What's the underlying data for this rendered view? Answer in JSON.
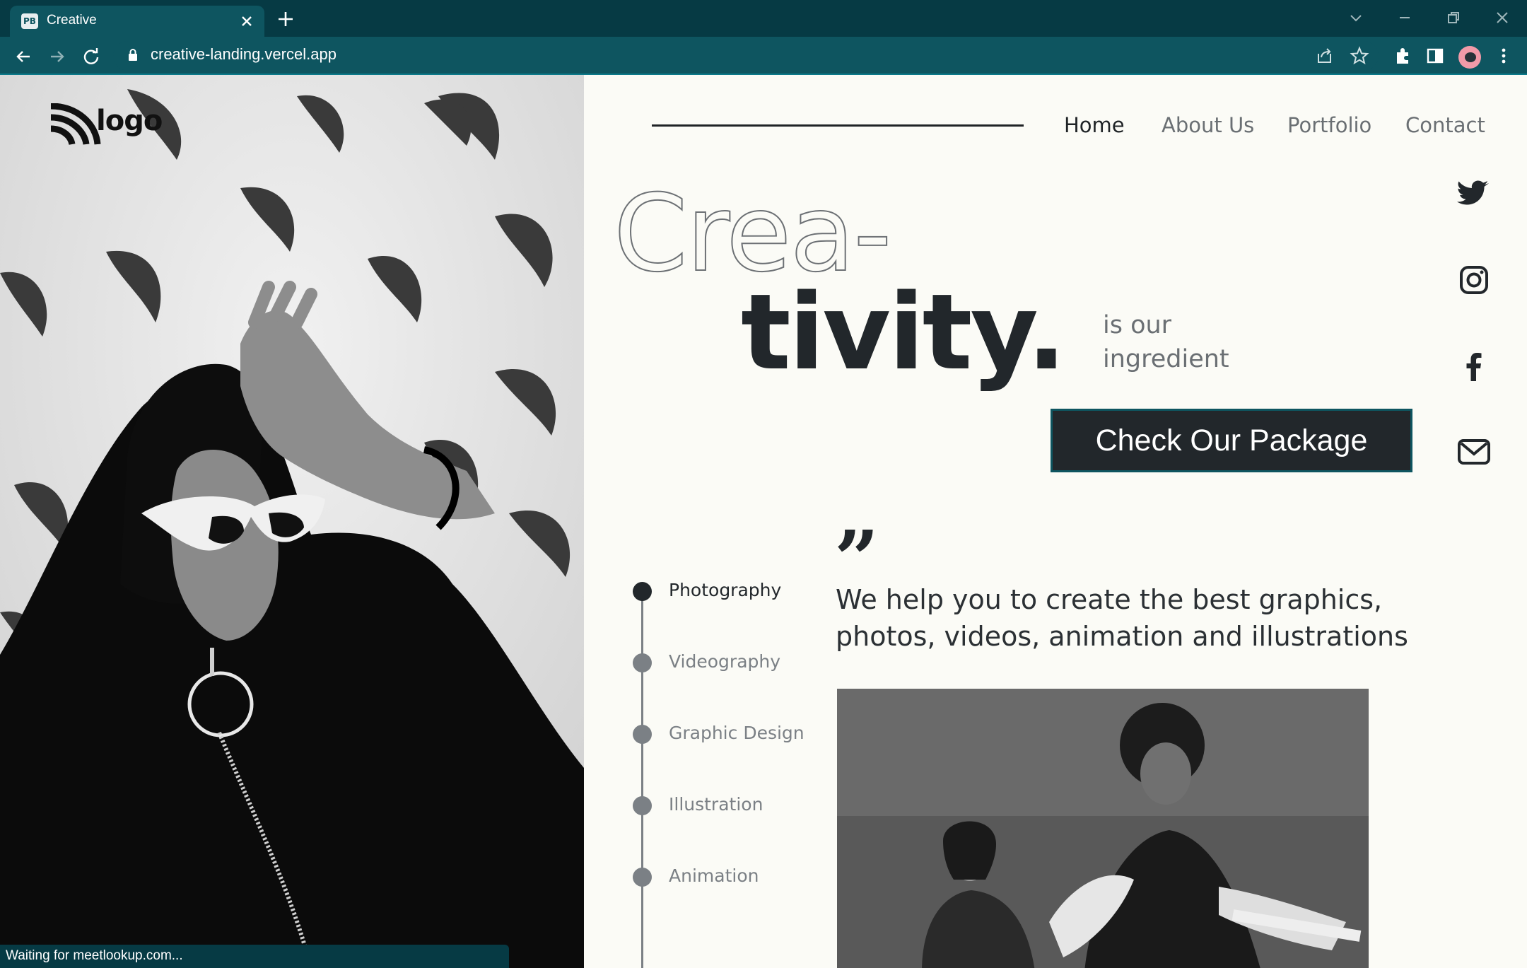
{
  "browser": {
    "tab_title": "Creative",
    "favicon_text": "PB",
    "url": "creative-landing.vercel.app",
    "status_text": "Waiting for meetlookup.com..."
  },
  "page": {
    "logo_text": "logo",
    "nav": {
      "items": [
        {
          "label": "Home",
          "active": true
        },
        {
          "label": "About Us",
          "active": false
        },
        {
          "label": "Portfolio",
          "active": false
        },
        {
          "label": "Contact",
          "active": false
        }
      ]
    },
    "headline": {
      "part1": "Crea-",
      "part2": "tivity.",
      "tagline_line1": "is our",
      "tagline_line2": "ingredient"
    },
    "cta_label": "Check Our Package",
    "services": [
      {
        "label": "Photography",
        "active": true
      },
      {
        "label": "Videography",
        "active": false
      },
      {
        "label": "Graphic Design",
        "active": false
      },
      {
        "label": "Illustration",
        "active": false
      },
      {
        "label": "Animation",
        "active": false
      }
    ],
    "quote": {
      "mark": "”",
      "line1": "We help you to create the best graphics,",
      "line2": "photos, videos, animation and illustrations"
    },
    "social": [
      "twitter-icon",
      "instagram-icon",
      "facebook-icon",
      "mail-icon"
    ]
  }
}
